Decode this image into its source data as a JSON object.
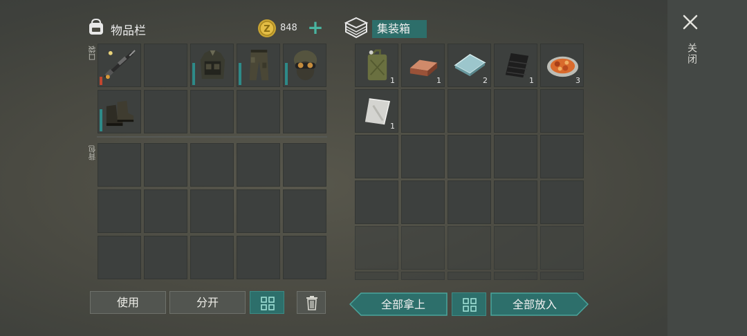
{
  "inventory": {
    "title": "物品栏",
    "coins": "848",
    "pocket_label": "口袋",
    "backpack_label": "背包",
    "pocket_slots": [
      {
        "item": "sniper-rifle",
        "bar": "red",
        "row": 0,
        "col": 0
      },
      {
        "item": null,
        "row": 0,
        "col": 1
      },
      {
        "item": "tactical-vest",
        "bar": "teal",
        "row": 0,
        "col": 2
      },
      {
        "item": "camo-pants",
        "bar": "teal",
        "row": 0,
        "col": 3
      },
      {
        "item": "helmet-goggles",
        "bar": "teal",
        "row": 0,
        "col": 4
      },
      {
        "item": "combat-boots",
        "bar": "teal",
        "row": 1,
        "col": 0
      },
      {
        "item": null,
        "row": 1,
        "col": 1
      },
      {
        "item": null,
        "row": 1,
        "col": 2
      },
      {
        "item": null,
        "row": 1,
        "col": 3
      },
      {
        "item": null,
        "row": 1,
        "col": 4
      }
    ]
  },
  "container": {
    "title": "集装箱",
    "items": [
      {
        "item": "jerry-can",
        "qty": "1"
      },
      {
        "item": "copper-ingot",
        "qty": "1"
      },
      {
        "item": "glass-sheet",
        "qty": "2"
      },
      {
        "item": "rubber-sheet",
        "qty": "1"
      },
      {
        "item": "meat-stew",
        "qty": "3"
      },
      {
        "item": "steel-sheet",
        "qty": "1"
      }
    ]
  },
  "close": {
    "label": "关闭"
  },
  "buttons": {
    "use": "使用",
    "split": "分开",
    "take_all": "全部拿上",
    "put_all": "全部放入"
  },
  "colors": {
    "accent": "#2d6f6b",
    "highlight": "#49b4a0",
    "durability_low": "#c2462f"
  }
}
